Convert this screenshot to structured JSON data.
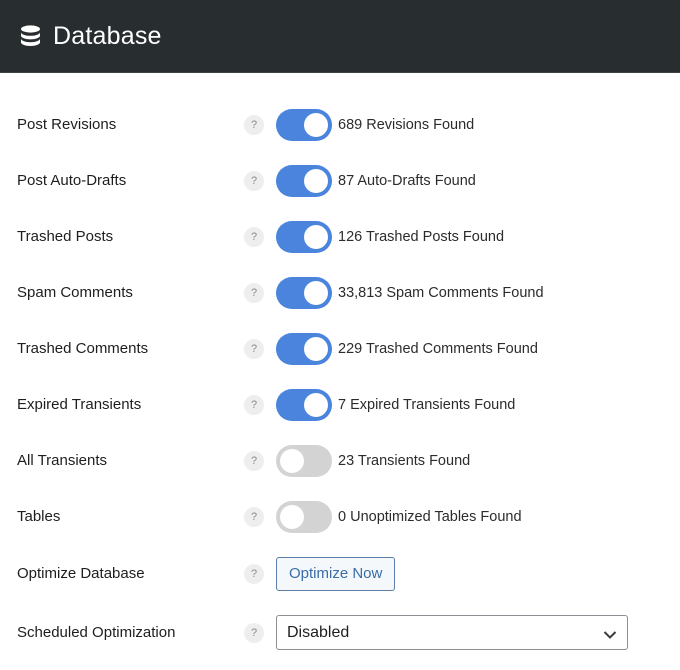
{
  "header": {
    "icon": "database-icon",
    "title": "Database"
  },
  "colors": {
    "header_bg": "#282e30",
    "toggle_on": "#4a84dc",
    "toggle_off": "#d3d3d3",
    "button_text": "#3a6ca8"
  },
  "help_glyph": "?",
  "rows": [
    {
      "label": "Post Revisions",
      "enabled": true,
      "status": "689 Revisions Found"
    },
    {
      "label": "Post Auto-Drafts",
      "enabled": true,
      "status": "87 Auto-Drafts Found"
    },
    {
      "label": "Trashed Posts",
      "enabled": true,
      "status": "126 Trashed Posts Found"
    },
    {
      "label": "Spam Comments",
      "enabled": true,
      "status": "33,813 Spam Comments Found"
    },
    {
      "label": "Trashed Comments",
      "enabled": true,
      "status": "229 Trashed Comments Found"
    },
    {
      "label": "Expired Transients",
      "enabled": true,
      "status": "7 Expired Transients Found"
    },
    {
      "label": "All Transients",
      "enabled": false,
      "status": "23 Transients Found"
    },
    {
      "label": "Tables",
      "enabled": false,
      "status": "0 Unoptimized Tables Found"
    }
  ],
  "optimize": {
    "label": "Optimize Database",
    "button_label": "Optimize Now"
  },
  "schedule": {
    "label": "Scheduled Optimization",
    "selected": "Disabled"
  }
}
